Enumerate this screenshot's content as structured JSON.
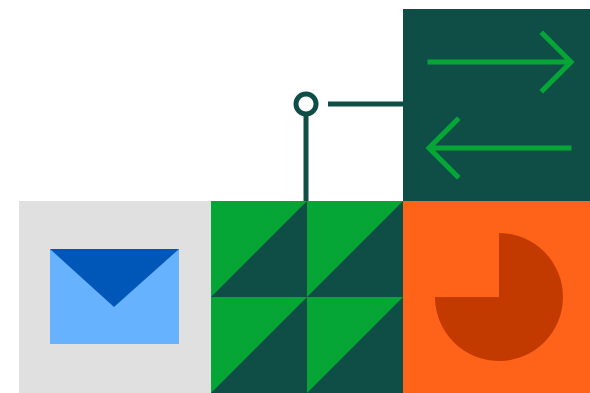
{
  "illustration": {
    "tiles": [
      {
        "name": "exchange-arrows-tile",
        "icon": "exchange-arrows-icon",
        "background": "#0e4e47",
        "accent": "#05a636"
      },
      {
        "name": "mail-tile",
        "icon": "envelope-icon",
        "background": "#e0e0e0",
        "accent": "#66b2ff",
        "accent_dark": "#0057b8"
      },
      {
        "name": "triangles-tile",
        "icon": "triangle-pattern-icon",
        "background": "#0e4e47",
        "accent": "#05a636"
      },
      {
        "name": "chart-tile",
        "icon": "pie-chart-icon",
        "background": "#ff6319",
        "accent": "#c23a00"
      }
    ],
    "connector": {
      "icon": "node-connector-icon",
      "color": "#0e4e47"
    }
  }
}
